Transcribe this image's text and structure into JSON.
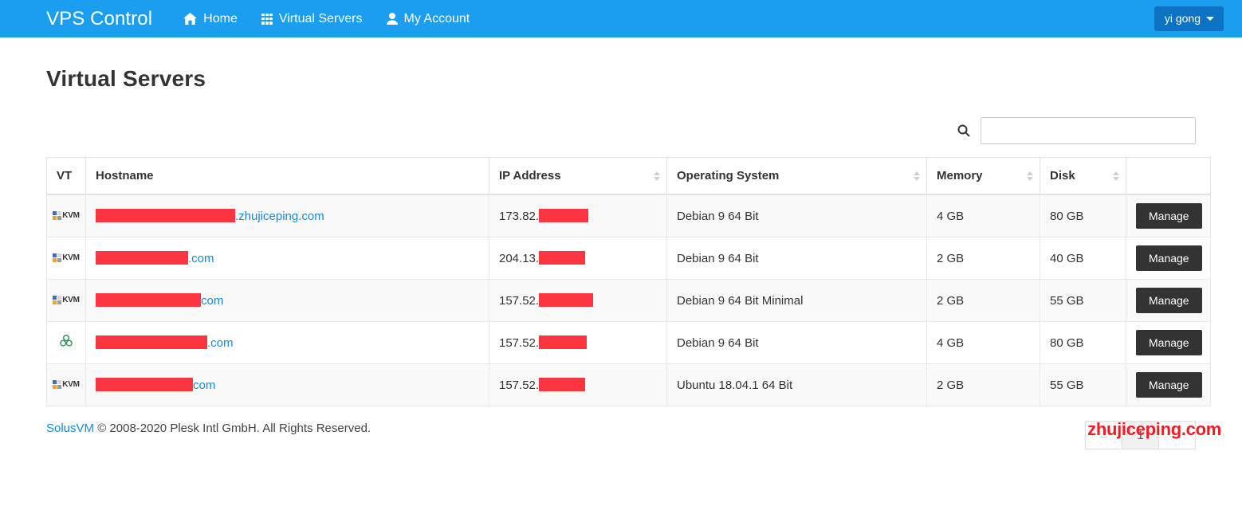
{
  "navbar": {
    "brand": "VPS Control",
    "items": [
      {
        "label": "Home",
        "icon": "home-icon"
      },
      {
        "label": "Virtual Servers",
        "icon": "grid-icon"
      },
      {
        "label": "My Account",
        "icon": "user-icon"
      }
    ],
    "user_menu": {
      "label": "yi gong",
      "icon": "caret-down-icon"
    },
    "background_color": "#1b9df0",
    "user_menu_color": "#0d72c4"
  },
  "page": {
    "title": "Virtual Servers"
  },
  "search": {
    "icon": "search-icon",
    "value": "",
    "placeholder": ""
  },
  "table": {
    "columns": [
      {
        "label": "VT",
        "sortable": false
      },
      {
        "label": "Hostname",
        "sortable": false
      },
      {
        "label": "IP Address",
        "sortable": true
      },
      {
        "label": "Operating System",
        "sortable": true
      },
      {
        "label": "Memory",
        "sortable": true
      },
      {
        "label": "Disk",
        "sortable": true
      },
      {
        "label": "",
        "sortable": false
      }
    ],
    "rows": [
      {
        "vt": "KVM",
        "vt_icon": "kvm-icon",
        "host_redacted_width": 175,
        "host_suffix": ".zhujiceping.com",
        "ip_prefix": "173.82.",
        "ip_redacted_width": 62,
        "os": "Debian 9 64 Bit",
        "memory": "4 GB",
        "disk": "80 GB",
        "action": "Manage"
      },
      {
        "vt": "KVM",
        "vt_icon": "kvm-icon",
        "host_redacted_width": 116,
        "host_suffix": ".com",
        "ip_prefix": "204.13.",
        "ip_redacted_width": 58,
        "os": "Debian 9 64 Bit",
        "memory": "2 GB",
        "disk": "40 GB",
        "action": "Manage"
      },
      {
        "vt": "KVM",
        "vt_icon": "kvm-icon",
        "host_redacted_width": 132,
        "host_suffix": "com",
        "ip_prefix": "157.52.",
        "ip_redacted_width": 68,
        "os": "Debian 9 64 Bit Minimal",
        "memory": "2 GB",
        "disk": "55 GB",
        "action": "Manage"
      },
      {
        "vt": "",
        "vt_icon": "openvz-icon",
        "host_redacted_width": 140,
        "host_suffix": ".com",
        "ip_prefix": "157.52.",
        "ip_redacted_width": 60,
        "os": "Debian 9 64 Bit",
        "memory": "4 GB",
        "disk": "80 GB",
        "action": "Manage"
      },
      {
        "vt": "KVM",
        "vt_icon": "kvm-icon",
        "host_redacted_width": 122,
        "host_suffix": "com",
        "ip_prefix": "157.52.",
        "ip_redacted_width": 58,
        "os": "Ubuntu 18.04.1 64 Bit",
        "memory": "2 GB",
        "disk": "55 GB",
        "action": "Manage"
      }
    ]
  },
  "pagination": {
    "prev": "←",
    "next": "→",
    "pages": [
      "1"
    ],
    "current": "1"
  },
  "footer": {
    "link": "SolusVM",
    "text": " © 2008-2020 Plesk Intl GmbH. All Rights Reserved."
  },
  "watermark": {
    "text": "zhujiceping.com",
    "color": "#ee1c25"
  }
}
